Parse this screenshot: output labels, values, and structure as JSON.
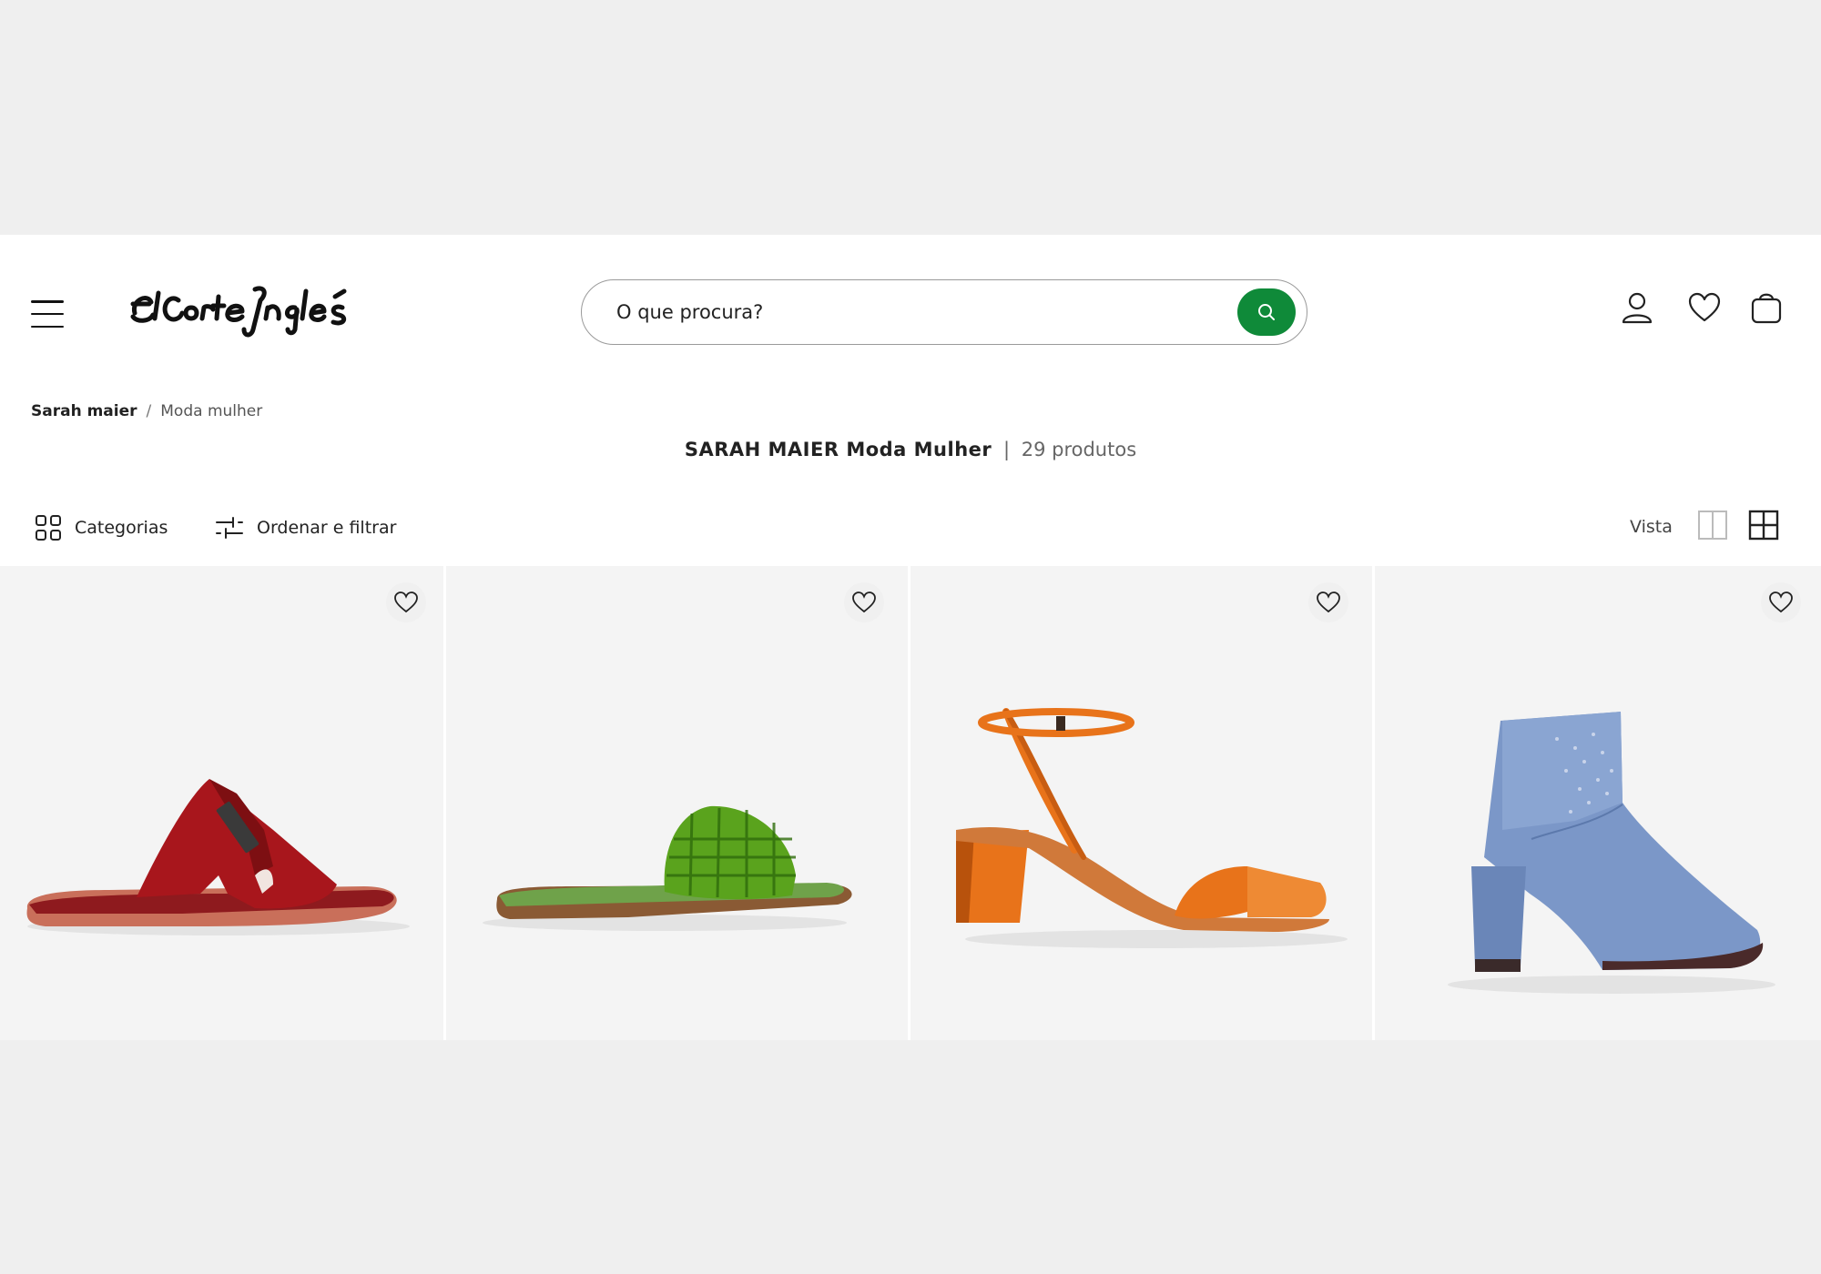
{
  "header": {
    "logo_text": "El Corte Inglés",
    "search": {
      "placeholder": "O que procura?"
    },
    "icons": [
      "menu-icon",
      "search-icon",
      "user-icon",
      "heart-icon",
      "shopping-bag-icon"
    ]
  },
  "breadcrumb": {
    "items": [
      "Sarah maier",
      "Moda mulher"
    ],
    "separator": "/"
  },
  "title": {
    "brand_line": "SARAH MAIER Moda Mulher",
    "separator": "|",
    "count": "29 produtos"
  },
  "toolbar": {
    "categories_label": "Categorias",
    "filter_label": "Ordenar e filtrar",
    "view_label": "Vista"
  },
  "products": [
    {
      "name": "red leather slide sandal",
      "color": "#a8161c"
    },
    {
      "name": "green metallic woven slide",
      "color": "#5aa31d"
    },
    {
      "name": "orange metallic block-heel sandal",
      "color": "#e8731a"
    },
    {
      "name": "denim ankle boot",
      "color": "#7b97c8"
    }
  ],
  "colors": {
    "accent_green": "#0f8a39",
    "page_bg": "#efefef",
    "card_bg": "#f4f4f4"
  }
}
